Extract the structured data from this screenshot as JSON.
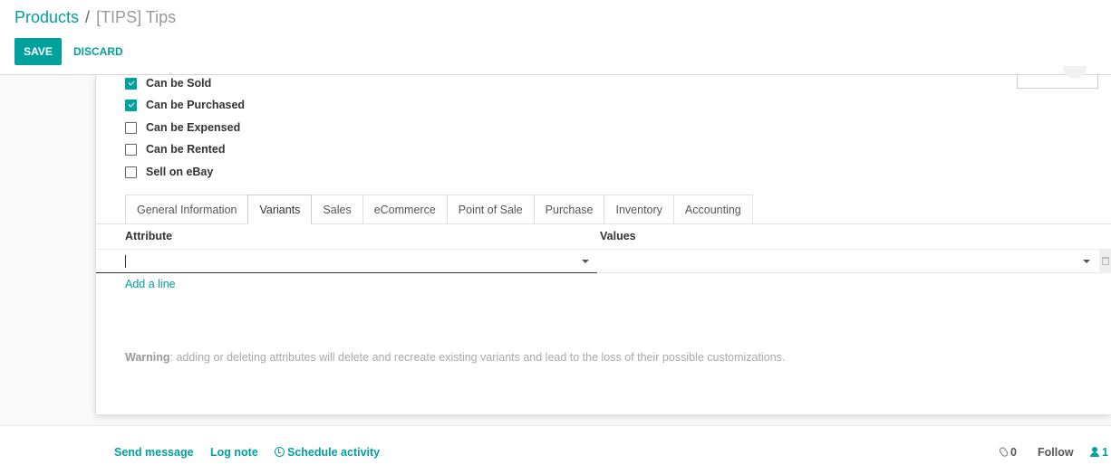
{
  "breadcrumb": {
    "parent": "Products",
    "separator": "/",
    "current": "[TIPS] Tips"
  },
  "toolbar": {
    "save_label": "SAVE",
    "discard_label": "DISCARD"
  },
  "options": [
    {
      "label": "Can be Sold",
      "checked": true
    },
    {
      "label": "Can be Purchased",
      "checked": true
    },
    {
      "label": "Can be Expensed",
      "checked": false
    },
    {
      "label": "Can be Rented",
      "checked": false
    },
    {
      "label": "Sell on eBay",
      "checked": false
    }
  ],
  "tabs": [
    {
      "label": "General Information"
    },
    {
      "label": "Variants",
      "active": true
    },
    {
      "label": "Sales"
    },
    {
      "label": "eCommerce"
    },
    {
      "label": "Point of Sale"
    },
    {
      "label": "Purchase"
    },
    {
      "label": "Inventory"
    },
    {
      "label": "Accounting"
    }
  ],
  "variants": {
    "columns": {
      "attribute": "Attribute",
      "values": "Values"
    },
    "attribute_value": "",
    "values_value": "",
    "add_line": "Add a line",
    "warning_title": "Warning",
    "warning_text": ": adding or deleting attributes will delete and recreate existing variants and lead to the loss of their possible customizations."
  },
  "chatter": {
    "send_message": "Send message",
    "log_note": "Log note",
    "schedule_activity": "Schedule activity",
    "attachments_count": "0",
    "follow_label": "Follow",
    "followers_count": "1"
  },
  "colors": {
    "accent": "#00a09d",
    "text": "#333333",
    "muted": "#a9a9a9"
  },
  "icons": [
    "check-icon",
    "caret-down-icon",
    "trash-icon",
    "clock-icon",
    "paperclip-icon",
    "user-icon"
  ]
}
